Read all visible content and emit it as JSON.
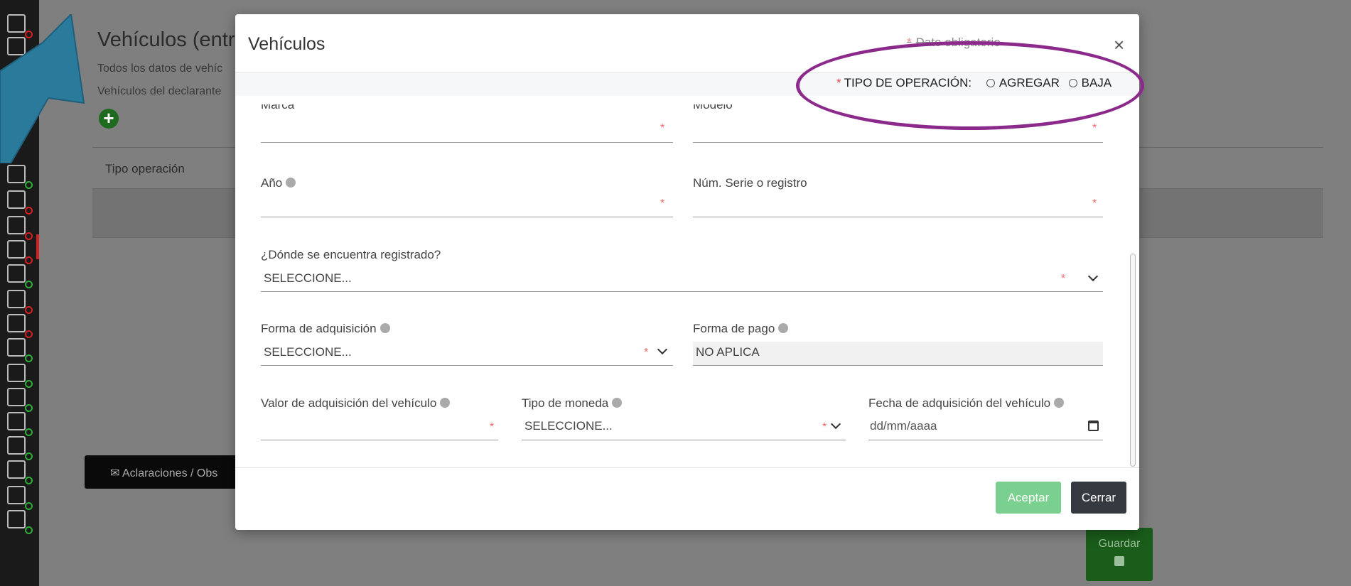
{
  "background": {
    "title": "Vehículos (entre",
    "subtitle1": "Todos los datos de vehíc",
    "subtitle2": "Vehículos del declarante",
    "add_icon": "plus-circle-icon",
    "table_header": "Tipo operación",
    "aclaraciones_label": "✉ Aclaraciones / Obs",
    "guardar_label": "Guardar"
  },
  "modal": {
    "title": "Vehículos",
    "required_note": "Dato obligatorio",
    "close_label": "×",
    "operation": {
      "label": "TIPO DE OPERACIÓN:",
      "options": [
        "AGREGAR",
        "BAJA"
      ]
    },
    "fields": {
      "marca": {
        "label": "Marca",
        "value": ""
      },
      "modelo": {
        "label": "Modelo",
        "value": ""
      },
      "anio": {
        "label": "Año",
        "value": ""
      },
      "num_serie": {
        "label": "Núm. Serie o registro",
        "value": ""
      },
      "donde_registrado": {
        "label": "¿Dónde se encuentra registrado?",
        "value": "SELECCIONE..."
      },
      "forma_adquisicion": {
        "label": "Forma de adquisición",
        "value": "SELECCIONE..."
      },
      "forma_pago": {
        "label": "Forma de pago",
        "value": "NO APLICA"
      },
      "valor_adquisicion": {
        "label": "Valor de adquisición del vehículo",
        "value": ""
      },
      "tipo_moneda": {
        "label": "Tipo de moneda",
        "value": "SELECCIONE..."
      },
      "fecha_adquisicion": {
        "label": "Fecha de adquisición del vehículo",
        "placeholder": "dd/mm/aaaa"
      }
    },
    "buttons": {
      "accept": "Aceptar",
      "close": "Cerrar"
    }
  },
  "colors": {
    "overlay": "#7f7f7f",
    "accept": "#79d08f",
    "close": "#343a40",
    "required": "#f06a6a",
    "annotation_oval": "#8b2a8b",
    "annotation_arrow": "#2a7a9c"
  }
}
